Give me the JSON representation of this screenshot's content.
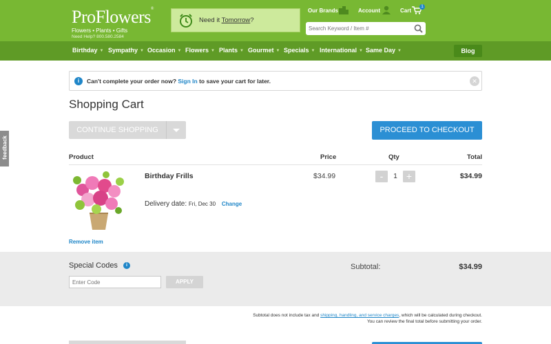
{
  "header": {
    "logo": "ProFlowers",
    "logo_mark": "®",
    "logo_sub": "Flowers  •  Plants  •  Gifts",
    "need_help": "Need Help? 800.580.2584",
    "tomorrow_prefix": "Need it ",
    "tomorrow_link": "Tomorrow",
    "tomorrow_suffix": "?",
    "our_brands": "Our Brands",
    "account": "Account",
    "cart": "Cart",
    "cart_count": "1",
    "search_placeholder": "Search Keyword / Item #"
  },
  "nav": {
    "items": [
      "Birthday",
      "Sympathy",
      "Occasion",
      "Flowers",
      "Plants",
      "Gourmet",
      "Specials",
      "International",
      "Same Day"
    ],
    "blog": "Blog"
  },
  "alert": {
    "text_before": "Can't complete your order now? ",
    "link": "Sign In",
    "text_after": " to save your cart for later."
  },
  "page_title": "Shopping Cart",
  "buttons": {
    "continue": "CONTINUE SHOPPING",
    "checkout": "PROCEED TO CHECKOUT"
  },
  "table": {
    "headers": {
      "product": "Product",
      "price": "Price",
      "qty": "Qty",
      "total": "Total"
    },
    "item": {
      "name": "Birthday Frills",
      "delivery_label": "Delivery date:",
      "delivery_date": "Fri, Dec 30",
      "change": "Change",
      "price": "$34.99",
      "qty": "1",
      "minus": "-",
      "plus": "+",
      "total": "$34.99",
      "remove": "Remove item"
    }
  },
  "codes": {
    "label": "Special Codes",
    "placeholder": "Enter Code",
    "apply": "APPLY",
    "subtotal_label": "Subtotal:",
    "subtotal": "$34.99"
  },
  "note": {
    "line1_before": "Subtotal does not include tax and ",
    "line1_link": "shipping, handling, and service charges",
    "line1_after": ", which will be calculated during checkout.",
    "line2": "You can review the final total before submitting your order."
  },
  "feedback": "feedback",
  "colors": {
    "brand_green": "#78b833",
    "nav_green": "#5f9b26",
    "link_blue": "#1f86c8",
    "checkout_blue": "#2b8fd4"
  }
}
